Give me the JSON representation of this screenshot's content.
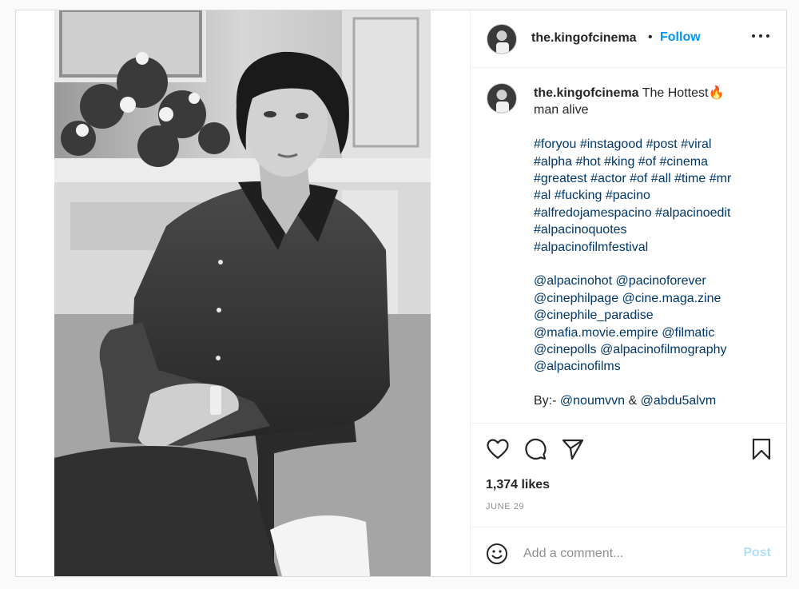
{
  "post": {
    "username": "the.kingofcinema",
    "follow_label": "Follow",
    "separator": "•",
    "photo_alt": "Black and white photo of a man in a dark shirt seated in a chair"
  },
  "caption": {
    "username": "the.kingofcinema",
    "lines": [
      "The Hottest🔥",
      "man alive",
      "",
      "#foryou #instagood #post #viral",
      "#alpha #hot #king #of #cinema",
      "#greatest #actor #of #all #time #mr",
      "#al #fucking #pacino",
      "#alfredojamespacino #alpacinoedit",
      "#alpacinoquotes",
      "#alpacinofilmfestival",
      "",
      "@alpacinohot @pacinoforever",
      "@cinephilpage @cine.maga.zine",
      "@cinephile_paradise",
      "@mafia.movie.empire @filmatic",
      "@cinepolls @alpacinofilmography",
      "@alpacinofilms",
      "",
      "By:- @noumvvn & @abdu5alvm"
    ]
  },
  "engagement": {
    "likes": "1,374 likes",
    "date": "JUNE 29"
  },
  "comment": {
    "placeholder": "Add a comment...",
    "post_label": "Post"
  },
  "icons": {
    "like": "heart-icon",
    "comment": "comment-icon",
    "share": "send-icon",
    "save": "bookmark-icon",
    "emoji": "emoji-icon",
    "more": "more-options-icon"
  },
  "colors": {
    "link_blue": "#0095f6",
    "hashtag": "#00376b",
    "post_disabled": "#b2dffc",
    "muted": "#8e8e8e"
  }
}
